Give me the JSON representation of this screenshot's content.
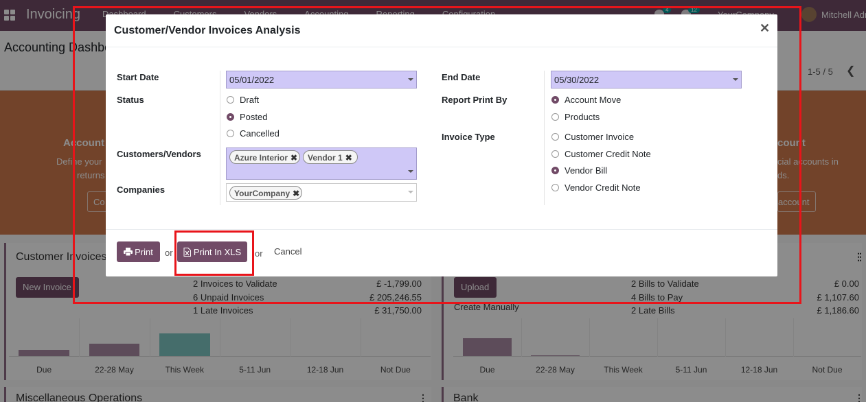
{
  "navbar": {
    "app_name": "Invoicing",
    "menu": [
      "Dashboard",
      "Customers",
      "Vendors",
      "Accounting",
      "Reporting",
      "Configuration"
    ],
    "activity_badge": "4",
    "message_badge": "12",
    "company": "YourCompany",
    "user": "Mitchell Admin"
  },
  "control_panel": {
    "title": "Accounting Dashboard",
    "pager": "1-5 / 5"
  },
  "banner": {
    "left_title": "Account",
    "left_text": [
      "Define your t",
      "returns"
    ],
    "left_button": "Co",
    "right_title": "count",
    "right_text": [
      "cial accounts in",
      "ds."
    ],
    "right_button": "account"
  },
  "customer_card": {
    "title": "Customer Invoices",
    "new_button": "New Invoice",
    "stats": [
      "2 Invoices to Validate",
      "6 Unpaid Invoices",
      "1 Late Invoices"
    ],
    "values": [
      "£ -1,799.00",
      "£ 205,246.55",
      "£ 31,750.00"
    ]
  },
  "vendor_card": {
    "upload_button": "Upload",
    "create_manually": "Create Manually",
    "stats": [
      "2 Bills to Validate",
      "4 Bills to Pay",
      "2 Late Bills"
    ],
    "values": [
      "£ 0.00",
      "£ 1,107.60",
      "£ 1,186.60"
    ]
  },
  "misc_card": {
    "title": "Miscellaneous Operations"
  },
  "bank_card": {
    "title": "Bank"
  },
  "chart_data": [
    {
      "type": "bar",
      "categories": [
        "Due",
        "22-28 May",
        "This Week",
        "5-11 Jun",
        "12-18 Jun",
        "Not Due"
      ],
      "colors": [
        "#a98ba5",
        "#a98ba5",
        "#7ec7c3",
        "#a98ba5",
        "#a98ba5",
        "#a98ba5"
      ],
      "values": [
        9,
        18,
        33,
        0,
        0,
        0
      ]
    },
    {
      "type": "bar",
      "categories": [
        "Due",
        "22-28 May",
        "This Week",
        "5-11 Jun",
        "12-18 Jun",
        "Not Due"
      ],
      "colors": [
        "#a98ba5",
        "#a98ba5",
        "#a98ba5",
        "#a98ba5",
        "#a98ba5",
        "#a98ba5"
      ],
      "values": [
        26,
        1,
        0,
        0,
        0,
        0
      ]
    }
  ],
  "modal": {
    "title": "Customer/Vendor Invoices Analysis",
    "close_icon": "close-icon",
    "start_date_label": "Start Date",
    "start_date": "05/01/2022",
    "end_date_label": "End Date",
    "end_date": "05/30/2022",
    "status_label": "Status",
    "status_options": [
      {
        "label": "Draft",
        "checked": false
      },
      {
        "label": "Posted",
        "checked": true
      },
      {
        "label": "Cancelled",
        "checked": false
      }
    ],
    "report_print_by_label": "Report Print By",
    "report_print_by_options": [
      {
        "label": "Account Move",
        "checked": true
      },
      {
        "label": "Products",
        "checked": false
      }
    ],
    "invoice_type_label": "Invoice Type",
    "invoice_type_options": [
      {
        "label": "Customer Invoice",
        "checked": false
      },
      {
        "label": "Customer Credit Note",
        "checked": false
      },
      {
        "label": "Vendor Bill",
        "checked": true
      },
      {
        "label": "Vendor Credit Note",
        "checked": false
      }
    ],
    "customers_vendors_label": "Customers/Vendors",
    "customers_vendors_tags": [
      "Azure Interior",
      "Vendor 1"
    ],
    "companies_label": "Companies",
    "companies_tags": [
      "YourCompany"
    ],
    "print_button": "Print",
    "print_xls_button": "Print In XLS",
    "or_text": "or",
    "cancel_button": "Cancel"
  },
  "colors": {
    "navbar": "#714B67",
    "primary": "#714B67",
    "input_bg": "#cfc8f7",
    "highlight": "#e8141a"
  }
}
